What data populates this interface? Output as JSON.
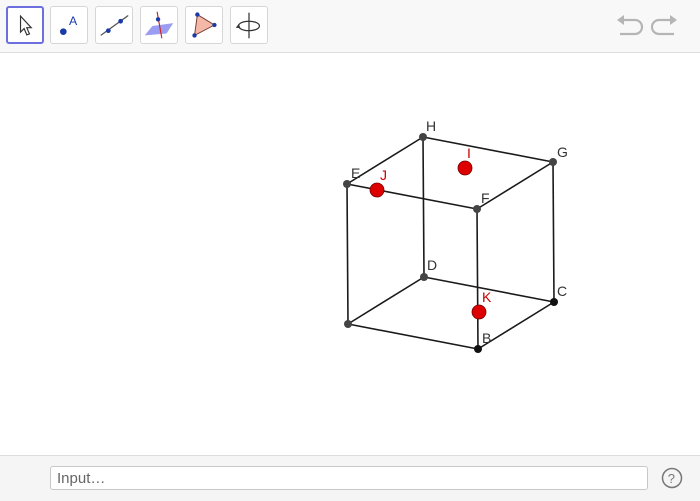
{
  "toolbar": {
    "tools": [
      {
        "id": "move",
        "icon": "move-arrow-icon",
        "active": true
      },
      {
        "id": "point",
        "icon": "point-tool-icon",
        "glyph": "A"
      },
      {
        "id": "line",
        "icon": "line-tool-icon"
      },
      {
        "id": "perpendicular",
        "icon": "perpendicular-plane-icon"
      },
      {
        "id": "polygon",
        "icon": "polygon-tool-icon"
      },
      {
        "id": "rotate",
        "icon": "rotate-view-icon"
      }
    ],
    "undo_icon": "undo-icon",
    "redo_icon": "redo-icon"
  },
  "graphics": {
    "cube_vertices": [
      {
        "label": "H"
      },
      {
        "label": "G"
      },
      {
        "label": "E"
      },
      {
        "label": "F"
      },
      {
        "label": "D"
      },
      {
        "label": "C"
      },
      {
        "label": "B"
      }
    ],
    "points": [
      {
        "label": "I",
        "color": "#cc0000"
      },
      {
        "label": "J",
        "color": "#cc0000"
      },
      {
        "label": "K",
        "color": "#cc0000"
      }
    ]
  },
  "input_bar": {
    "placeholder": "Input…"
  },
  "help": {
    "icon": "help-icon",
    "glyph": "?"
  },
  "colors": {
    "accent": "#6e6fdf",
    "point_red": "#cc0000",
    "vertex": "#444444",
    "edge": "#1a1a1a"
  }
}
